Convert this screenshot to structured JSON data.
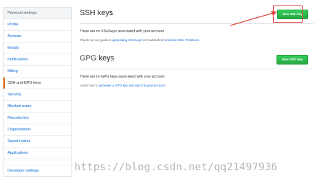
{
  "sidebar": {
    "heading": "Personal settings",
    "items": [
      {
        "label": "Profile"
      },
      {
        "label": "Account"
      },
      {
        "label": "Emails"
      },
      {
        "label": "Notifications"
      },
      {
        "label": "Billing"
      },
      {
        "label": "SSH and GPG keys",
        "selected": true
      },
      {
        "label": "Security"
      },
      {
        "label": "Blocked users"
      },
      {
        "label": "Repositories"
      },
      {
        "label": "Organizations"
      },
      {
        "label": "Saved replies"
      },
      {
        "label": "Applications"
      }
    ],
    "developer": "Developer settings"
  },
  "ssh": {
    "title": "SSH keys",
    "button": "New SSH key",
    "empty_text": "There are no SSH keys associated with your account.",
    "help_prefix": "Check out our guide to ",
    "help_link1": "generating SSH keys",
    "help_mid": " or troubleshoot ",
    "help_link2": "common SSH Problems",
    "help_suffix": "."
  },
  "gpg": {
    "title": "GPG keys",
    "button": "New GPG key",
    "empty_text": "There are no GPG keys associated with your account.",
    "help_prefix": "Learn how to ",
    "help_link1": "generate a GPG key and add it to your account",
    "help_suffix": "."
  },
  "watermark": "https://blog.csdn.net/qq21497936",
  "colors": {
    "accent_green": "#28a745",
    "link_blue": "#0366d6",
    "selected_marker": "#e36209",
    "annotation_red": "#e0463e"
  }
}
